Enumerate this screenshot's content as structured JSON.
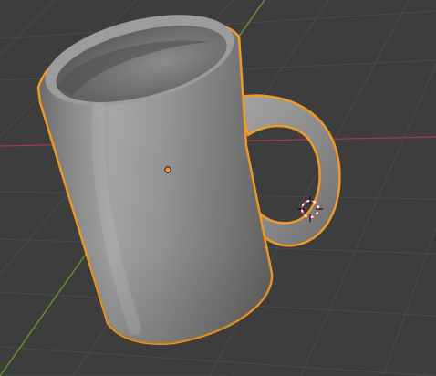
{
  "viewport": {
    "background_color": "#3d3d3d",
    "grid_color": "#4b4b4b",
    "x_axis_color": "#a23a47",
    "y_axis_color": "#6a9a2c"
  },
  "selected_object": {
    "icon": "mug-mesh-icon",
    "outline_color": "#f09a28",
    "origin_color": "#f29a2c"
  },
  "cursor_3d": {
    "icon": "3d-cursor-icon",
    "ring_colors": [
      "#e04545",
      "#ffffff"
    ]
  }
}
